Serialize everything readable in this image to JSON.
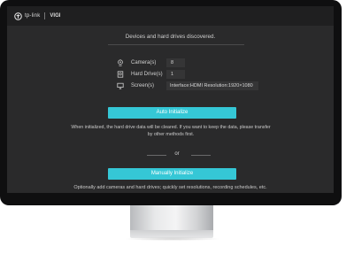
{
  "brand": {
    "name": "tp-link",
    "product": "VIGI"
  },
  "setup": {
    "headline": "Devices and hard drives discovered.",
    "rows": [
      {
        "label": "Camera(s)",
        "value": "8",
        "icon": "camera-icon"
      },
      {
        "label": "Hard Drive(s)",
        "value": "1",
        "icon": "hard-drive-icon"
      },
      {
        "label": "Screen(s)",
        "value": "Interface:HDMI Resolution:1920×1080",
        "icon": "monitor-icon"
      }
    ],
    "auto_button": "Auto Initialize",
    "auto_note": "When initialized, the hard drive data will be cleared. If you want to keep the data, please transfer by other methods first.",
    "or_text": "or",
    "manual_button": "Manually Initialize",
    "manual_note": "Optionally add cameras and hard drives; quickly set resolutions, recording schedules, etc."
  },
  "colors": {
    "accent": "#35c7d6",
    "screen_bg": "#2a2a2b",
    "bezel": "#0f0f10"
  }
}
